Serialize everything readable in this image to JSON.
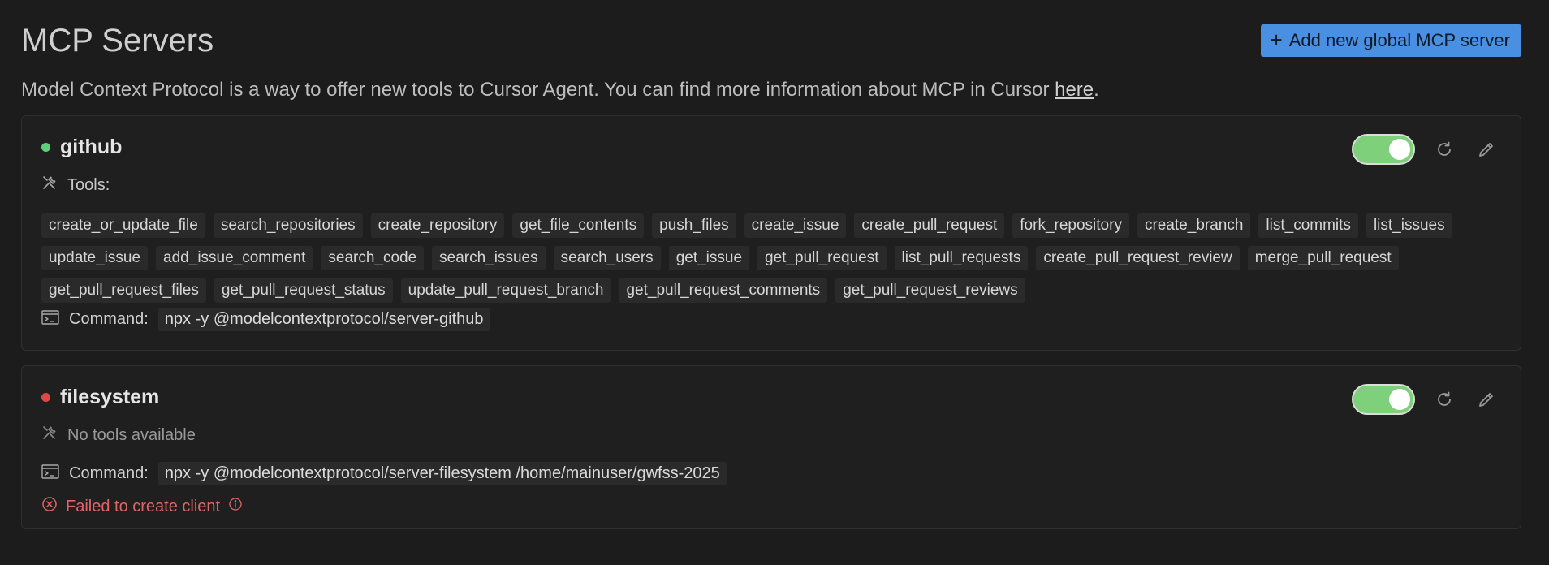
{
  "header": {
    "title": "MCP Servers",
    "add_button_label": "Add new global MCP server"
  },
  "intro": {
    "text_before": "Model Context Protocol is a way to offer new tools to Cursor Agent. You can find more information about MCP in Cursor ",
    "link_text": "here",
    "text_after": "."
  },
  "colors": {
    "accent": "#4a90e2",
    "status_ok": "#5fce7b",
    "status_error": "#e04848",
    "toggle_on": "#7ed07a"
  },
  "servers": [
    {
      "name": "github",
      "status": "ok",
      "enabled": true,
      "tools_label": "Tools:",
      "tools": [
        "create_or_update_file",
        "search_repositories",
        "create_repository",
        "get_file_contents",
        "push_files",
        "create_issue",
        "create_pull_request",
        "fork_repository",
        "create_branch",
        "list_commits",
        "list_issues",
        "update_issue",
        "add_issue_comment",
        "search_code",
        "search_issues",
        "search_users",
        "get_issue",
        "get_pull_request",
        "list_pull_requests",
        "create_pull_request_review",
        "merge_pull_request",
        "get_pull_request_files",
        "get_pull_request_status",
        "update_pull_request_branch",
        "get_pull_request_comments",
        "get_pull_request_reviews"
      ],
      "command_label": "Command:",
      "command": "npx -y @modelcontextprotocol/server-github"
    },
    {
      "name": "filesystem",
      "status": "error",
      "enabled": true,
      "tools_label": "No tools available",
      "command_label": "Command:",
      "command": "npx -y @modelcontextprotocol/server-filesystem /home/mainuser/gwfss-2025",
      "error": "Failed to create client"
    }
  ]
}
